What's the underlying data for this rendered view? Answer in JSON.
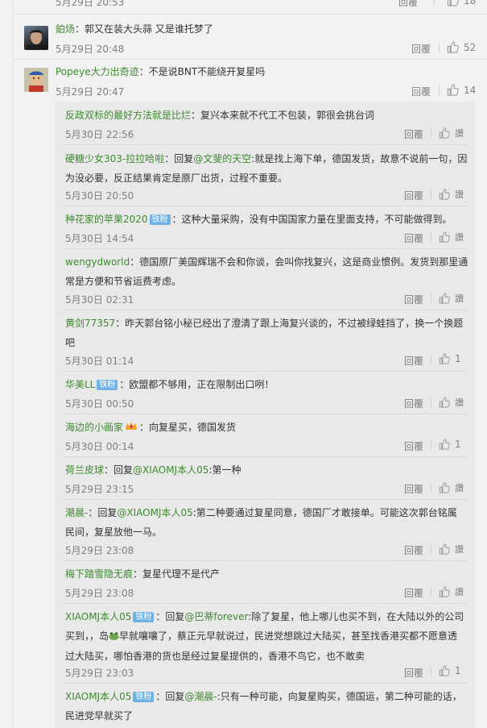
{
  "top_comments": [
    {
      "time": "5月29日 20:53",
      "reply": "回覆",
      "likes": "18"
    },
    {
      "user": "鉑炀",
      "sep": "：",
      "text": "郭又在装大头蒜  又是谁托梦了",
      "time": "5月29日 20:48",
      "reply": "回覆",
      "likes": "52"
    },
    {
      "user": "Popeye大力出奇迹",
      "sep": "：",
      "text": "不是说BNT不能绕开复星吗",
      "time": "5月29日 20:47",
      "reply": "回覆",
      "likes": "14"
    }
  ],
  "sub_comments": [
    {
      "user": "反政双标的最好方法就是比烂",
      "l1": "：复兴本来就不代工不包装，郭很会挑台词",
      "time": "5月30日 22:56",
      "reply": "回覆",
      "likes": "讚"
    },
    {
      "user": "硬糖少女303-拉拉哈啦",
      "pre": "：回复",
      "mention": "@文斐的天空",
      "l1": ":就是找上海下单，德国发货，故意不说前一句，因",
      "l2": "为没必要，反正结果肯定是原厂出货，过程不重要。",
      "time": "5月30日 20:50",
      "reply": "回覆",
      "likes": "讚"
    },
    {
      "user": "种花家的苹果2020",
      "badge": "铁粉",
      "l1": "：这种大量采购，没有中国国家力量在里面支持，不可能做得到。",
      "time": "5月30日 14:54",
      "reply": "回覆",
      "likes": "讚"
    },
    {
      "user": "wengydworld",
      "l1": "：德国原厂美国辉瑞不会和你谈，会叫你找复兴，这是商业惯例。发货到那里通",
      "l2": "常是方便和节省运费考虑。",
      "time": "5月30日 02:31",
      "reply": "回覆",
      "likes": "讚"
    },
    {
      "user": "黄剑77357",
      "l1": "：昨天郭台铭小秘已经出了澄清了跟上海复兴谈的，不过被绿蛙挡了，换一个换题",
      "l2": "吧",
      "time": "5月30日 01:14",
      "reply": "回覆",
      "likes": "1"
    },
    {
      "user": "华美LL",
      "badge": "铁粉",
      "l1": "：欧盟都不够用，正在限制出口咧！",
      "time": "5月30日 00:50",
      "reply": "回覆",
      "likes": "讚"
    },
    {
      "user": "海边的小画家",
      "l1": "：向复星买，德国发货",
      "time": "5月30日 00:14",
      "reply": "回覆",
      "likes": "1"
    },
    {
      "user": "荷兰皮球",
      "pre": "：回复",
      "mention": "@XIAOMJ本人05",
      "l1": ":第一种",
      "time": "5月29日 23:15",
      "reply": "回覆",
      "likes": "讚"
    },
    {
      "user": "潮晨-",
      "pre": "：回复",
      "mention": "@XIAOMJ本人05",
      "l1": ":第二种要通过复星同意，德国厂才敢接单。可能这次郭台铭属",
      "l2": "民间，复星放他一马。",
      "time": "5月29日 23:08",
      "reply": "回覆",
      "likes": "讚"
    },
    {
      "user": "梅下踏雪隐无痕",
      "l1": "：复星代理不是代产",
      "time": "5月29日 23:08",
      "reply": "回覆",
      "likes": "讚"
    },
    {
      "user": "XIAOMJ本人05",
      "badge": "铁粉",
      "pre": "：回复",
      "mention": "@巴蒂forever",
      "l1": ":除了复星，他上哪儿也买不到，在大陆以外的公司",
      "l2": "买到，，岛",
      "l2b": "早就嚷嚷了，蔡正元早就说过，民进党想跳过大陆买，甚至找香港买都不愿意透",
      "l3": "过大陆买，哪怕香港的货也是经过复星提供的，香港不鸟它，也不敢卖",
      "time": "5月29日 23:03",
      "reply": "回覆",
      "likes": "1"
    },
    {
      "user": "XIAOMJ本人05",
      "badge": "铁粉",
      "pre": "：回复",
      "mention": "@潮晨-",
      "l1": ":只有一种可能，向复星购买，德国运，第二种可能的话，",
      "l2": "民进党早就买了"
    }
  ]
}
